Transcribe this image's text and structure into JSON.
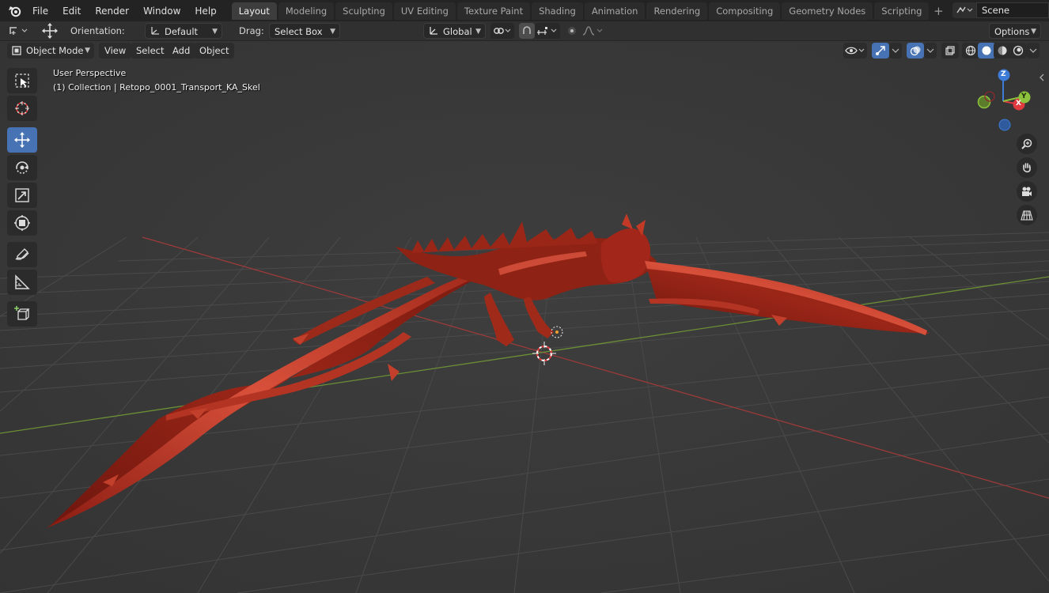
{
  "menu": {
    "items": [
      "File",
      "Edit",
      "Render",
      "Window",
      "Help"
    ]
  },
  "workspaces": {
    "tabs": [
      "Layout",
      "Modeling",
      "Sculpting",
      "UV Editing",
      "Texture Paint",
      "Shading",
      "Animation",
      "Rendering",
      "Compositing",
      "Geometry Nodes",
      "Scripting"
    ],
    "active": "Layout",
    "add_symbol": "+"
  },
  "scene": {
    "name": "Scene"
  },
  "tool_header": {
    "orientation_label": "Orientation:",
    "orientation_value": "Default",
    "drag_label": "Drag:",
    "drag_value": "Select Box",
    "transform_orientation": "Global",
    "options_label": "Options"
  },
  "viewport_header": {
    "mode": "Object Mode",
    "menus": [
      "View",
      "Select",
      "Add",
      "Object"
    ]
  },
  "overlay": {
    "view_name": "User Perspective",
    "collection_info": "(1) Collection | Retopo_0001_Transport_KA_Skel"
  },
  "toolbar": {
    "tools": [
      "select-box-icon",
      "cursor-icon",
      "move-icon",
      "rotate-icon",
      "scale-icon",
      "transform-icon",
      "annotate-icon",
      "measure-icon",
      "add-cube-icon"
    ],
    "active_tool": "move-icon"
  },
  "gizmo": {
    "axes": [
      "Z",
      "Y",
      "X"
    ]
  },
  "nav_buttons": [
    "zoom-icon",
    "hand-pan-icon",
    "camera-view-icon",
    "perspective-grid-icon"
  ],
  "colors": {
    "accent": "#4772b3",
    "viewport_bg": "#3a3a3a",
    "axis_x": "#e0393f",
    "axis_y": "#8cc23c",
    "axis_z": "#3e7bd6",
    "model": "#a3261a"
  }
}
